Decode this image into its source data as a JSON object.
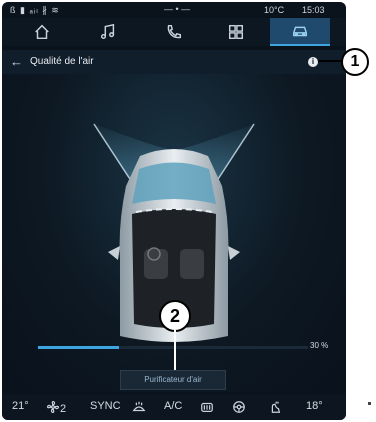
{
  "status_bar": {
    "left_icons": "ß ▮ ₐᵢₗ ∦ ≋",
    "center": "— • —",
    "temperature": "10°C",
    "time": "15:03"
  },
  "nav": {
    "tabs": [
      {
        "icon": "home-icon",
        "active": false
      },
      {
        "icon": "music-icon",
        "active": false
      },
      {
        "icon": "phone-icon",
        "active": false
      },
      {
        "icon": "apps-icon",
        "active": false
      },
      {
        "icon": "car-icon",
        "active": true
      }
    ]
  },
  "header": {
    "back": "←",
    "title": "Qualité de l'air",
    "info": "i"
  },
  "callouts": {
    "one": "1",
    "two": "2"
  },
  "main": {
    "progress_percent": 30,
    "percent_label": "30 %",
    "purifier_button": "Purificateur d'air"
  },
  "climate_bar": {
    "left_temp": "21°",
    "fan_level": "2",
    "sync": "SYNC",
    "ac": "A/C",
    "right_temp": "18°"
  },
  "colors": {
    "accent": "#3ea5e0",
    "background": "#0a121c"
  }
}
